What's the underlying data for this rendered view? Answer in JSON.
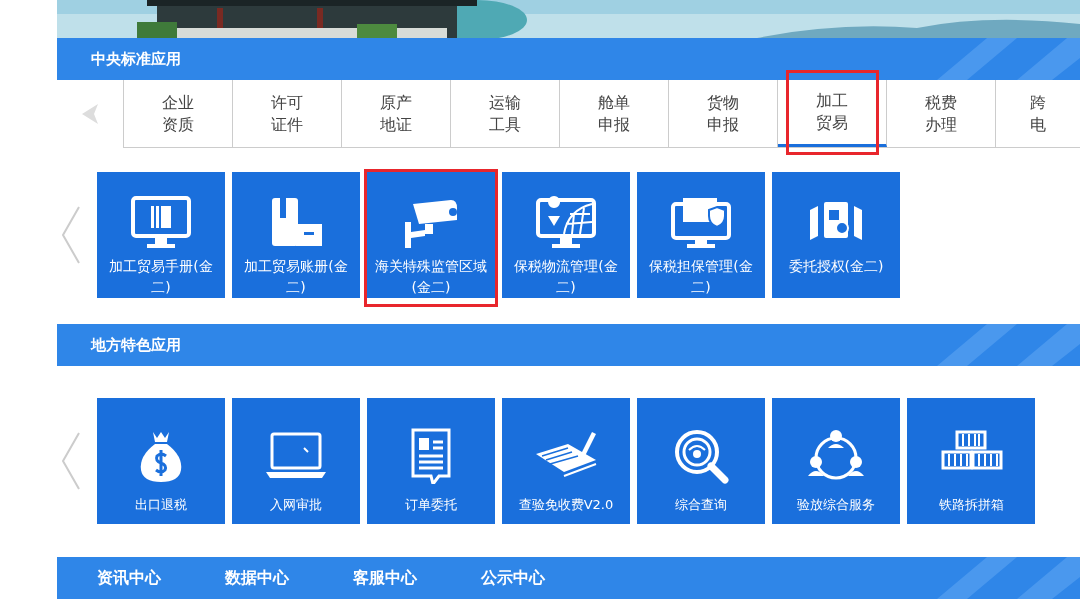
{
  "central": {
    "title": "中央标准应用",
    "tabs": [
      {
        "lines": [
          "企业",
          "资质"
        ],
        "selected": false,
        "annotated": false
      },
      {
        "lines": [
          "许可",
          "证件"
        ],
        "selected": false,
        "annotated": false
      },
      {
        "lines": [
          "原产",
          "地证"
        ],
        "selected": false,
        "annotated": false
      },
      {
        "lines": [
          "运输",
          "工具"
        ],
        "selected": false,
        "annotated": false
      },
      {
        "lines": [
          "舱单",
          "申报"
        ],
        "selected": false,
        "annotated": false
      },
      {
        "lines": [
          "货物",
          "申报"
        ],
        "selected": false,
        "annotated": false
      },
      {
        "lines": [
          "加工",
          "贸易"
        ],
        "selected": true,
        "annotated": true
      },
      {
        "lines": [
          "税费",
          "办理"
        ],
        "selected": false,
        "annotated": false
      },
      {
        "lines": [
          "跨",
          "电"
        ],
        "selected": false,
        "annotated": false
      }
    ],
    "tiles": [
      {
        "label": "加工贸易手册(金二)",
        "annotated": false
      },
      {
        "label": "加工贸易账册(金二)",
        "annotated": false
      },
      {
        "label": "海关特殊监管区域(金二)",
        "annotated": true
      },
      {
        "label": "保税物流管理(金二)",
        "annotated": false
      },
      {
        "label": "保税担保管理(金二)",
        "annotated": false
      },
      {
        "label": "委托授权(金二)",
        "annotated": false
      }
    ]
  },
  "local": {
    "title": "地方特色应用",
    "tiles": [
      {
        "label": "出口退税"
      },
      {
        "label": "入网审批"
      },
      {
        "label": "订单委托"
      },
      {
        "label": "查验免收费V2.0"
      },
      {
        "label": "综合查询"
      },
      {
        "label": "验放综合服务"
      },
      {
        "label": "铁路拆拼箱"
      }
    ]
  },
  "footer_links": [
    "资讯中心",
    "数据中心",
    "客服中心",
    "公示中心"
  ]
}
